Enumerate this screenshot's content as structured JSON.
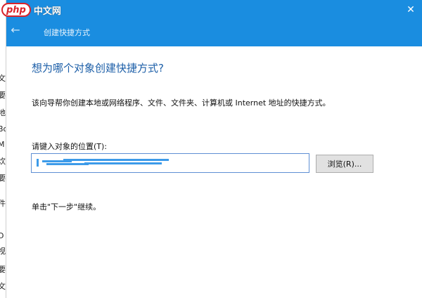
{
  "window": {
    "title": "创建快捷方式"
  },
  "watermark": {
    "brand": "php",
    "site": "中文网"
  },
  "background_window": {
    "fragments": [
      "文",
      "要",
      "地",
      "Bo",
      "M",
      "炊",
      "要",
      "件",
      "D",
      "视",
      "要",
      "文"
    ]
  },
  "main": {
    "heading": "想为哪个对象创建快捷方式?",
    "description": "该向导帮你创建本地或网络程序、文件、文件夹、计算机或 Internet 地址的快捷方式。",
    "location_label": "请键入对象的位置(T):",
    "location_value": "",
    "browse_label": "浏览(R)...",
    "hint": "单击\"下一步\"继续。"
  },
  "colors": {
    "titlebar": "#1a8de0",
    "heading": "#1d5fa8",
    "input_border": "#5f8fd4",
    "button_bg": "#e1e1e1"
  },
  "icons": {
    "close": "close-icon",
    "back": "back-arrow-icon"
  }
}
